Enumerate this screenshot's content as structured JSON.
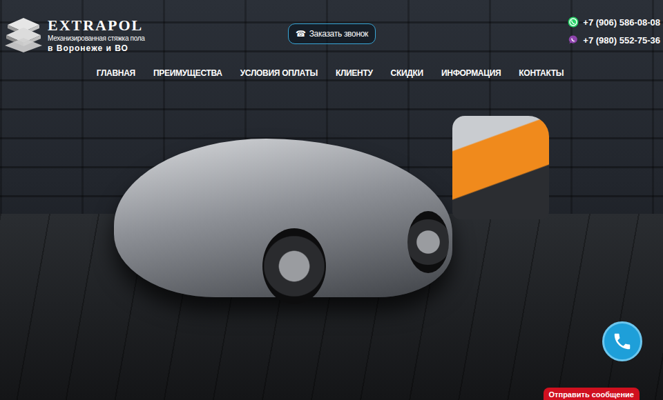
{
  "logo": {
    "title": "EXTRAPOL",
    "subtitle": "Механизированная стяжка пола",
    "region": "в Воронеже и ВО"
  },
  "callback_button": {
    "icon": "☎",
    "label": "Заказать звонок"
  },
  "phones": [
    {
      "number": "+7 (906) 586-08-08",
      "kind": "whatsapp",
      "color": "#25d366"
    },
    {
      "number": "+7 (980) 552-75-36",
      "kind": "viber",
      "color": "#8e44ad"
    }
  ],
  "nav": [
    {
      "label": "ГЛАВНАЯ"
    },
    {
      "label": "ПРЕИМУЩЕСТВА"
    },
    {
      "label": "УСЛОВИЯ ОПЛАТЫ"
    },
    {
      "label": "КЛИЕНТУ"
    },
    {
      "label": "СКИДКИ"
    },
    {
      "label": "ИНФОРМАЦИЯ"
    },
    {
      "label": "КОНТАКТЫ"
    }
  ],
  "message_tab": {
    "label": "Отправить сообщение"
  }
}
